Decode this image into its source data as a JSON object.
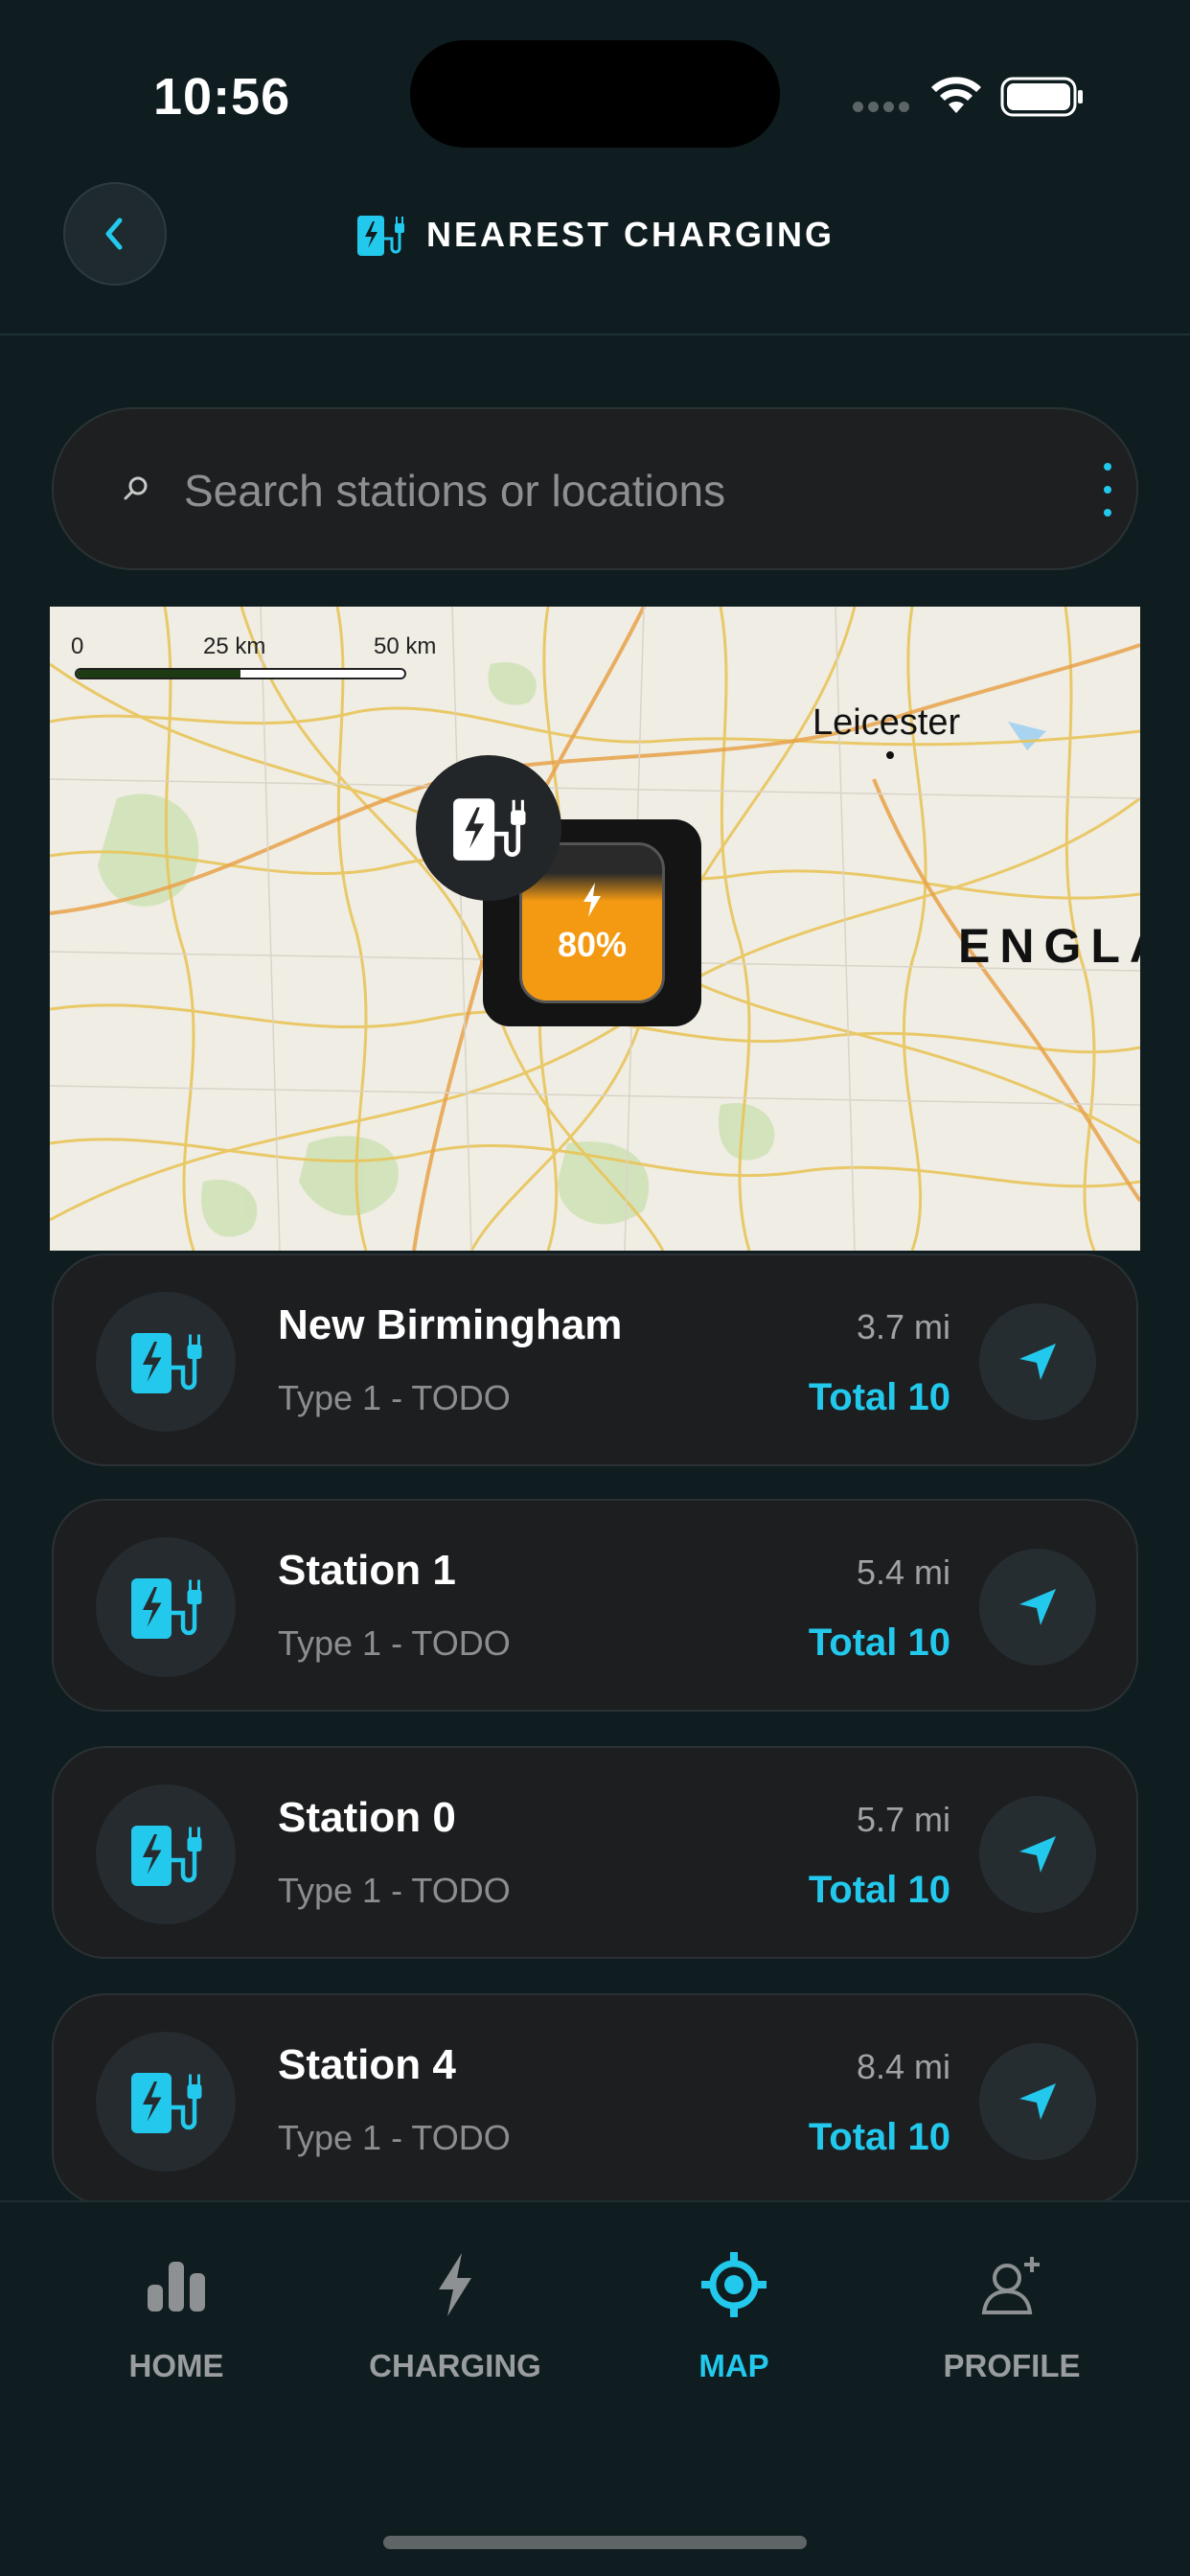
{
  "status_bar": {
    "time": "10:56"
  },
  "header": {
    "title": "NEAREST CHARGING",
    "back_icon": "chevron-left-icon",
    "title_icon": "ev-station-icon"
  },
  "search": {
    "placeholder": "Search stations or locations",
    "value": "",
    "icon": "search-icon",
    "menu_icon": "kebab-menu-icon"
  },
  "map": {
    "scale_labels": [
      "0",
      "25 km",
      "50 km"
    ],
    "city": "Leicester",
    "region": "ENGLA",
    "pin": {
      "battery_percent": "80%",
      "battery_level": 0.8
    }
  },
  "stations": [
    {
      "name": "New Birmingham",
      "type": "Type 1 - TODO",
      "distance": "3.7 mi",
      "total": "Total 10"
    },
    {
      "name": "Station 1",
      "type": "Type 1 - TODO",
      "distance": "5.4 mi",
      "total": "Total 10"
    },
    {
      "name": "Station 0",
      "type": "Type 1 - TODO",
      "distance": "5.7 mi",
      "total": "Total 10"
    },
    {
      "name": "Station 4",
      "type": "Type 1 - TODO",
      "distance": "8.4 mi",
      "total": "Total 10"
    }
  ],
  "tabs": [
    {
      "label": "HOME",
      "icon": "bar-chart-icon",
      "active": false
    },
    {
      "label": "CHARGING",
      "icon": "bolt-icon",
      "active": false
    },
    {
      "label": "MAP",
      "icon": "locate-target-icon",
      "active": true
    },
    {
      "label": "PROFILE",
      "icon": "user-add-icon",
      "active": false
    }
  ],
  "colors": {
    "accent": "#22c9ec",
    "background": "#0f1d20",
    "card": "#1c1e20",
    "battery": "#f39a12"
  }
}
